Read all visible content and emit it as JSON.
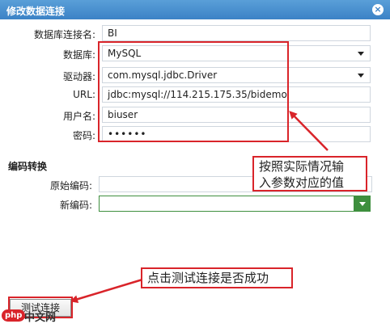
{
  "window": {
    "title": "修改数据连接",
    "close_glyph": "×"
  },
  "form": {
    "conn_name": {
      "label": "数据库连接名:",
      "value": "BI"
    },
    "database": {
      "label": "数据库:",
      "value": "MySQL"
    },
    "driver": {
      "label": "驱动器:",
      "value": "com.mysql.jdbc.Driver"
    },
    "url": {
      "label": "URL:",
      "value": "jdbc:mysql://114.215.175.35/bidemo"
    },
    "username": {
      "label": "用户名:",
      "value": "biuser"
    },
    "password": {
      "label": "密码:",
      "value": "••••••"
    }
  },
  "encoding": {
    "section_title": "编码转换",
    "original": {
      "label": "原始编码:",
      "value": ""
    },
    "new": {
      "label": "新编码:",
      "value": ""
    }
  },
  "annotations": {
    "params_note_line1": "按照实际情况输",
    "params_note_line2": "入参数对应的值",
    "test_note": "点击测试连接是否成功"
  },
  "buttons": {
    "test_connection": "测试连接"
  },
  "watermark": {
    "badge": "php",
    "text": "中文网"
  },
  "colors": {
    "titlebar": "#3b82c6",
    "annotation_red": "#d9242a",
    "dropdown_green": "#3e8f3e"
  }
}
